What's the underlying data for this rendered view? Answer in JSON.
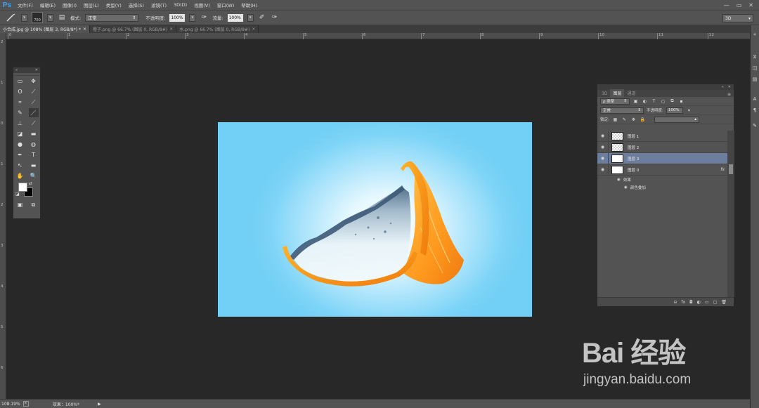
{
  "app": {
    "logo": "Ps",
    "menus": [
      "文件(F)",
      "编辑(E)",
      "图像(I)",
      "图层(L)",
      "类型(Y)",
      "选择(S)",
      "滤镜(T)",
      "3D(D)",
      "视图(V)",
      "窗口(W)",
      "帮助(H)"
    ],
    "window_controls": [
      "—",
      "▭",
      "✕"
    ]
  },
  "options_bar": {
    "brush_size": "700",
    "mode_label": "模式:",
    "mode_value": "正常",
    "opacity_label": "不透明度:",
    "opacity_value": "100%",
    "flow_label": "流量:",
    "flow_value": "100%",
    "workspace": "3D"
  },
  "tabs": [
    {
      "label": "小合成.jpg @ 108% (图层 3, RGB/8*) *",
      "close": "×",
      "active": true
    },
    {
      "label": "橙子.png @ 66.7% (图层 0, RGB/8#)",
      "close": "×",
      "active": false
    },
    {
      "label": "水.png @ 66.7% (图层 0, RGB/8#)",
      "close": "×",
      "active": false
    }
  ],
  "rulers": {
    "h": [
      "0",
      "1",
      "2",
      "3",
      "4",
      "5",
      "6",
      "7",
      "8",
      "9",
      "10",
      "11",
      "12"
    ],
    "v": [
      "2",
      "1",
      "0",
      "1",
      "2",
      "3",
      "4",
      "5",
      "6"
    ]
  },
  "tools": {
    "rows": [
      [
        "▭",
        "✥"
      ],
      [
        "ʘ",
        "⟋"
      ],
      [
        "⌗",
        "⟋"
      ],
      [
        "✎",
        "／"
      ],
      [
        "⊥",
        "⟋"
      ],
      [
        "◪",
        "▬"
      ],
      [
        "●",
        "◍"
      ],
      [
        "✒",
        "T"
      ],
      [
        "↖",
        "▬"
      ],
      [
        "✋",
        "🔍"
      ]
    ],
    "bottom": [
      "▣",
      "⧉"
    ],
    "colors": {
      "foreground": "#ffffff",
      "background": "#000000"
    }
  },
  "layers_panel": {
    "tabs": [
      "3D",
      "图层",
      "通道"
    ],
    "active_tab": "图层",
    "filter_label": "ρ 类型",
    "blend_mode": "正常",
    "opacity_label": "不透明度:",
    "opacity_value": "100%",
    "lock_label": "锁定:",
    "layers": [
      {
        "name": "图层 1",
        "thumb": "checker",
        "selected": false,
        "fx": ""
      },
      {
        "name": "图层 2",
        "thumb": "checker",
        "selected": false,
        "fx": ""
      },
      {
        "name": "图层 3",
        "thumb": "white",
        "selected": true,
        "fx": ""
      },
      {
        "name": "图层 0",
        "thumb": "white",
        "selected": false,
        "fx": "fx"
      }
    ],
    "effects_label": "效果",
    "effect_item": "颜色叠加",
    "bottom_icons": [
      "⊝",
      "fx",
      "◘",
      "◐",
      "▭",
      "▢",
      "🗑"
    ]
  },
  "status": {
    "zoom": "108.19%",
    "doc_info": "效果：100%*"
  },
  "watermark": {
    "brand": "Bai 经验",
    "url": "jingyan.baidu.com"
  },
  "colors": {
    "accent": "#31a8ff",
    "selection": "#6d7d9e",
    "canvas_blue": "#72cff5",
    "orange": "#f7941d"
  }
}
